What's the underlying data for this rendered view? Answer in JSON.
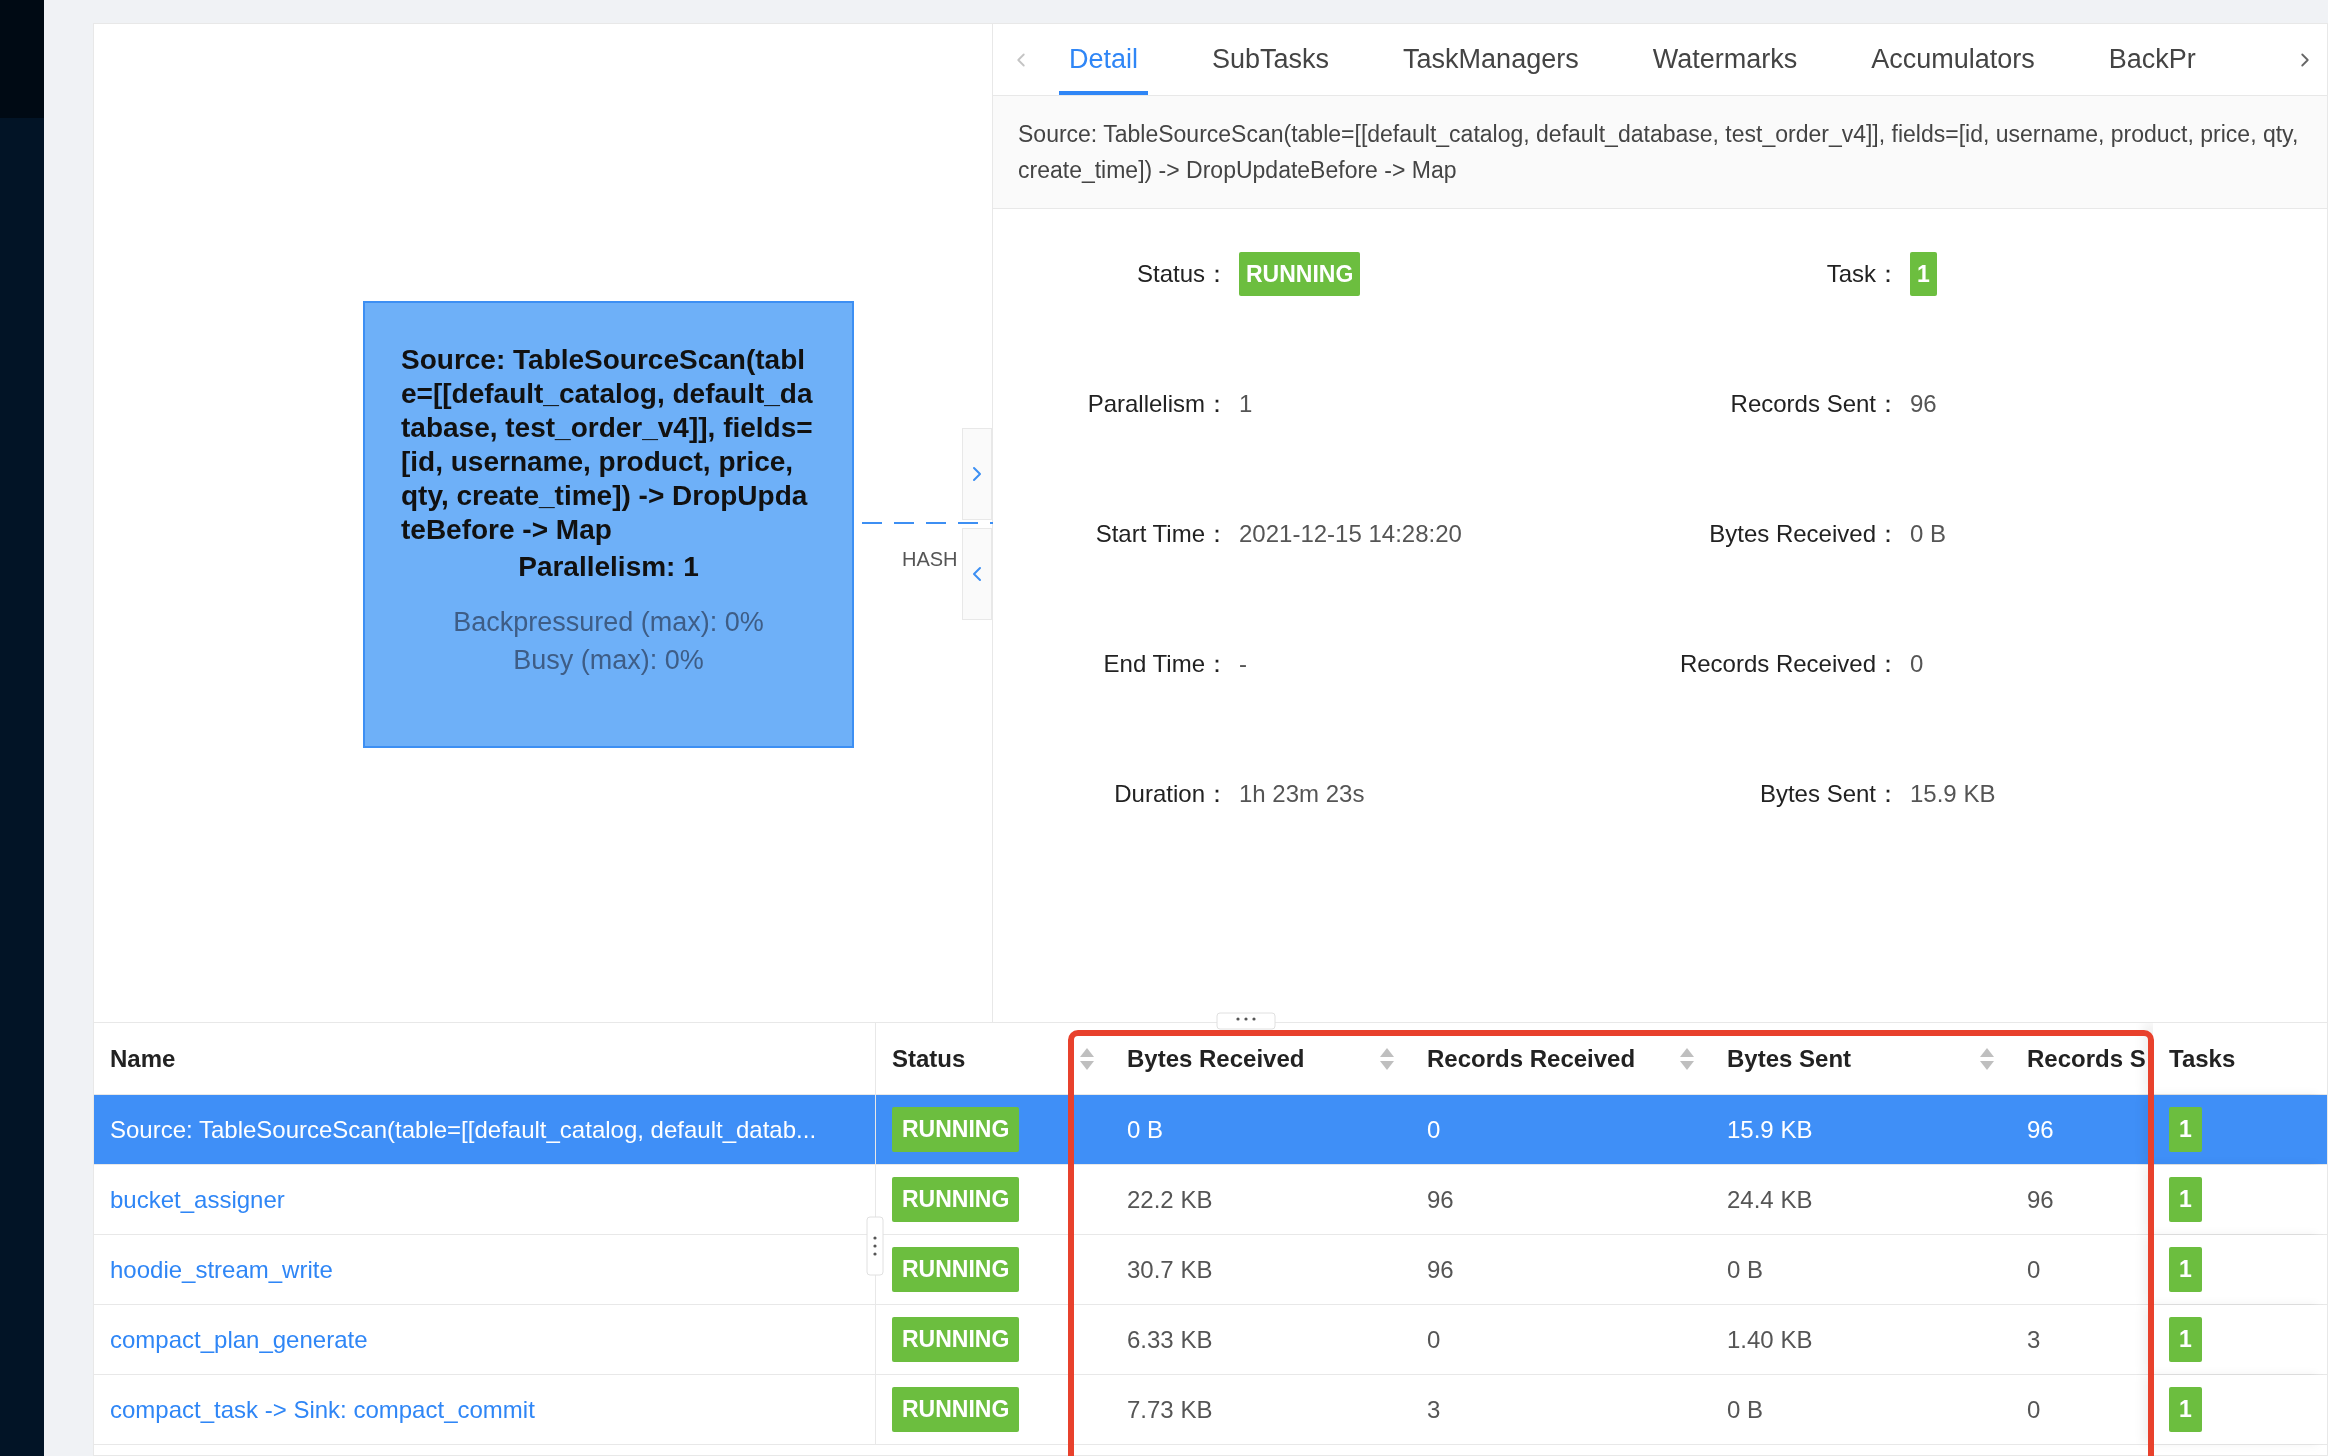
{
  "graph": {
    "node": {
      "title": "Source: TableSourceScan(table=[[default_catalog, default_database, test_order_v4]], fields=[id, username, product, price, qty, create_time]) -> DropUpdateBefore -> Map",
      "parallelism": "Parallelism: 1",
      "backpressured": "Backpressured (max): 0%",
      "busy": "Busy (max): 0%"
    },
    "edge_label": "HASH"
  },
  "tabs": [
    {
      "label": "Detail",
      "selected": true
    },
    {
      "label": "SubTasks",
      "selected": false
    },
    {
      "label": "TaskManagers",
      "selected": false
    },
    {
      "label": "Watermarks",
      "selected": false
    },
    {
      "label": "Accumulators",
      "selected": false
    },
    {
      "label": "BackPr",
      "selected": false
    }
  ],
  "description": "Source: TableSourceScan(table=[[default_catalog, default_database, test_order_v4]], fields=[id, username, product, price, qty, create_time]) -> DropUpdateBefore -> Map",
  "details": [
    {
      "label": "Status：",
      "value": "RUNNING",
      "kind": "tag"
    },
    {
      "label": "Task：",
      "value": "1",
      "kind": "tag"
    },
    {
      "label": "Parallelism：",
      "value": "1",
      "kind": "text"
    },
    {
      "label": "Records Sent：",
      "value": "96",
      "kind": "text"
    },
    {
      "label": "Start Time：",
      "value": "2021-12-15 14:28:20",
      "kind": "text"
    },
    {
      "label": "Bytes Received：",
      "value": "0 B",
      "kind": "text"
    },
    {
      "label": "End Time：",
      "value": "-",
      "kind": "text"
    },
    {
      "label": "Records Received：",
      "value": "0",
      "kind": "text"
    },
    {
      "label": "Duration：",
      "value": "1h 23m 23s",
      "kind": "text"
    },
    {
      "label": "Bytes Sent：",
      "value": "15.9 KB",
      "kind": "text"
    }
  ],
  "table": {
    "columns": [
      {
        "label": "Name",
        "sortable": false
      },
      {
        "label": "Status",
        "sortable": true
      },
      {
        "label": "Bytes Received",
        "sortable": true
      },
      {
        "label": "Records Received",
        "sortable": true
      },
      {
        "label": "Bytes Sent",
        "sortable": true
      },
      {
        "label": "Records S"
      },
      {
        "label": "Tasks",
        "sortable": false
      }
    ],
    "rows": [
      {
        "name": "Source: TableSourceScan(table=[[default_catalog, default_datab...",
        "status": "RUNNING",
        "bytes_received": "0 B",
        "records_received": "0",
        "bytes_sent": "15.9 KB",
        "records_sent": "96",
        "tasks": "1",
        "selected": true
      },
      {
        "name": "bucket_assigner",
        "status": "RUNNING",
        "bytes_received": "22.2 KB",
        "records_received": "96",
        "bytes_sent": "24.4 KB",
        "records_sent": "96",
        "tasks": "1",
        "selected": false
      },
      {
        "name": "hoodie_stream_write",
        "status": "RUNNING",
        "bytes_received": "30.7 KB",
        "records_received": "96",
        "bytes_sent": "0 B",
        "records_sent": "0",
        "tasks": "1",
        "selected": false
      },
      {
        "name": "compact_plan_generate",
        "status": "RUNNING",
        "bytes_received": "6.33 KB",
        "records_received": "0",
        "bytes_sent": "1.40 KB",
        "records_sent": "3",
        "tasks": "1",
        "selected": false
      },
      {
        "name": "compact_task -> Sink: compact_commit",
        "status": "RUNNING",
        "bytes_received": "7.73 KB",
        "records_received": "3",
        "bytes_sent": "0 B",
        "records_sent": "0",
        "tasks": "1",
        "selected": false
      }
    ]
  }
}
